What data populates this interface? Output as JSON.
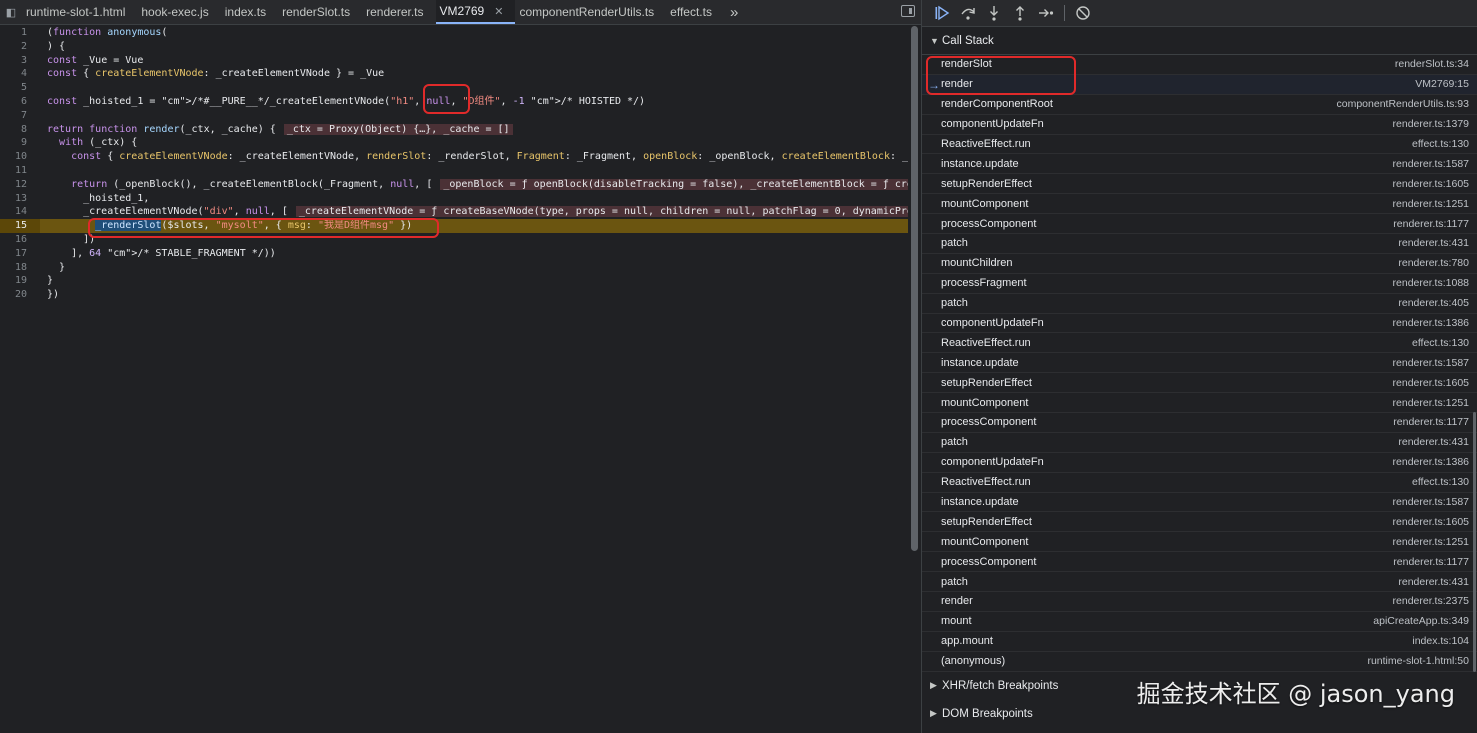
{
  "tabs": [
    {
      "label": "runtime-slot-1.html",
      "active": false
    },
    {
      "label": "hook-exec.js",
      "active": false
    },
    {
      "label": "index.ts",
      "active": false
    },
    {
      "label": "renderSlot.ts",
      "active": false
    },
    {
      "label": "renderer.ts",
      "active": false
    },
    {
      "label": "VM2769",
      "active": true
    },
    {
      "label": "componentRenderUtils.ts",
      "active": false
    },
    {
      "label": "effect.ts",
      "active": false
    }
  ],
  "icons": {
    "tab_close": "✕",
    "overflow": "»",
    "navigator": "◧",
    "frame_arrow": "→",
    "section_open": "▼",
    "section_closed": "▶"
  },
  "code": {
    "lines": [
      {
        "n": "1",
        "t": "(function anonymous("
      },
      {
        "n": "2",
        "t": ") {"
      },
      {
        "n": "3",
        "t": "const _Vue = Vue"
      },
      {
        "n": "4",
        "t": "const { createElementVNode: _createElementVNode } = _Vue"
      },
      {
        "n": "5",
        "t": ""
      },
      {
        "n": "6",
        "t": "const _hoisted_1 = /*#__PURE__*/_createElementVNode(\"h1\", null, \"D组件\", -1 /* HOISTED */)"
      },
      {
        "n": "7",
        "t": ""
      },
      {
        "n": "8",
        "t": "return function render(_ctx, _cache) {"
      },
      {
        "n": "9",
        "t": "  with (_ctx) {"
      },
      {
        "n": "10",
        "t": "    const { createElementVNode: _createElementVNode, renderSlot: _renderSlot, Fragment: _Fragment, openBlock: _openBlock, createElementBlock: _c"
      },
      {
        "n": "11",
        "t": ""
      },
      {
        "n": "12",
        "t": "    return (_openBlock(), _createElementBlock(_Fragment, null, ["
      },
      {
        "n": "13",
        "t": "      _hoisted_1,"
      },
      {
        "n": "14",
        "t": "      _createElementVNode(\"div\", null, ["
      },
      {
        "n": "15",
        "t": "        _renderSlot($slots, \"mysolt\", { msg: \"我是D组件msg\" })"
      },
      {
        "n": "16",
        "t": "      ])"
      },
      {
        "n": "17",
        "t": "    ], 64 /* STABLE_FRAGMENT */))"
      },
      {
        "n": "18",
        "t": "  }"
      },
      {
        "n": "19",
        "t": "}"
      },
      {
        "n": "20",
        "t": "})"
      }
    ],
    "inline_values": {
      "line8": "_ctx = Proxy(Object) {…}, _cache = []",
      "line12": "_openBlock = ƒ openBlock(disableTracking = false), _createElementBlock = ƒ cre",
      "line14": "_createElementVNode = ƒ createBaseVNode(type, props = null, children = null, patchFlag = 0, dynamicPro"
    },
    "paused_line": 15,
    "colors": {
      "paused_line_bg": "#5c4708",
      "annotation_red": "#e02a2a",
      "selection_blue": "#1f4e79"
    }
  },
  "call_stack": {
    "title": "Call Stack",
    "frames": [
      {
        "name": "renderSlot",
        "location": "renderSlot.ts:34"
      },
      {
        "name": "render",
        "location": "VM2769:15",
        "current": true
      },
      {
        "name": "renderComponentRoot",
        "location": "componentRenderUtils.ts:93"
      },
      {
        "name": "componentUpdateFn",
        "location": "renderer.ts:1379"
      },
      {
        "name": "ReactiveEffect.run",
        "location": "effect.ts:130"
      },
      {
        "name": "instance.update",
        "location": "renderer.ts:1587"
      },
      {
        "name": "setupRenderEffect",
        "location": "renderer.ts:1605"
      },
      {
        "name": "mountComponent",
        "location": "renderer.ts:1251"
      },
      {
        "name": "processComponent",
        "location": "renderer.ts:1177"
      },
      {
        "name": "patch",
        "location": "renderer.ts:431"
      },
      {
        "name": "mountChildren",
        "location": "renderer.ts:780"
      },
      {
        "name": "processFragment",
        "location": "renderer.ts:1088"
      },
      {
        "name": "patch",
        "location": "renderer.ts:405"
      },
      {
        "name": "componentUpdateFn",
        "location": "renderer.ts:1386"
      },
      {
        "name": "ReactiveEffect.run",
        "location": "effect.ts:130"
      },
      {
        "name": "instance.update",
        "location": "renderer.ts:1587"
      },
      {
        "name": "setupRenderEffect",
        "location": "renderer.ts:1605"
      },
      {
        "name": "mountComponent",
        "location": "renderer.ts:1251"
      },
      {
        "name": "processComponent",
        "location": "renderer.ts:1177"
      },
      {
        "name": "patch",
        "location": "renderer.ts:431"
      },
      {
        "name": "componentUpdateFn",
        "location": "renderer.ts:1386"
      },
      {
        "name": "ReactiveEffect.run",
        "location": "effect.ts:130"
      },
      {
        "name": "instance.update",
        "location": "renderer.ts:1587"
      },
      {
        "name": "setupRenderEffect",
        "location": "renderer.ts:1605"
      },
      {
        "name": "mountComponent",
        "location": "renderer.ts:1251"
      },
      {
        "name": "processComponent",
        "location": "renderer.ts:1177"
      },
      {
        "name": "patch",
        "location": "renderer.ts:431"
      },
      {
        "name": "render",
        "location": "renderer.ts:2375"
      },
      {
        "name": "mount",
        "location": "apiCreateApp.ts:349"
      },
      {
        "name": "app.mount",
        "location": "index.ts:104"
      },
      {
        "name": "(anonymous)",
        "location": "runtime-slot-1.html:50"
      }
    ]
  },
  "sections": {
    "xhr": "XHR/fetch Breakpoints",
    "dom": "DOM Breakpoints"
  },
  "watermark": "掘金技术社区 @ jason_yang"
}
